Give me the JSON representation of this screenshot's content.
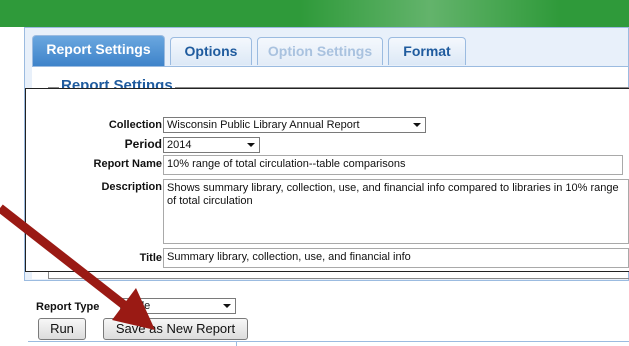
{
  "tabs": [
    {
      "label": "Report Settings",
      "state": "active"
    },
    {
      "label": "Options",
      "state": "normal"
    },
    {
      "label": "Option Settings",
      "state": "disabled"
    },
    {
      "label": "Format",
      "state": "normal"
    }
  ],
  "section": {
    "legend": "Report Settings"
  },
  "form": {
    "collection": {
      "label": "Collection",
      "value": "Wisconsin Public Library Annual Report"
    },
    "period": {
      "label": "Period",
      "value": "2014"
    },
    "report_name": {
      "label": "Report Name",
      "value": "10% range of total circulation--table comparisons"
    },
    "description": {
      "label": "Description",
      "value": "Shows summary library, collection, use, and financial  info compared to libraries in 10% range of total circulation"
    },
    "title": {
      "label": "Title",
      "value": "Summary library, collection, use, and financial  info"
    }
  },
  "report_type": {
    "label": "Report Type",
    "value": "Table"
  },
  "buttons": {
    "run": "Run",
    "save_new": "Save as New Report"
  },
  "colors": {
    "header_green": "#2f9a3a",
    "tab_blue": "#3d82c9",
    "arrow_red": "#9a1a14"
  }
}
